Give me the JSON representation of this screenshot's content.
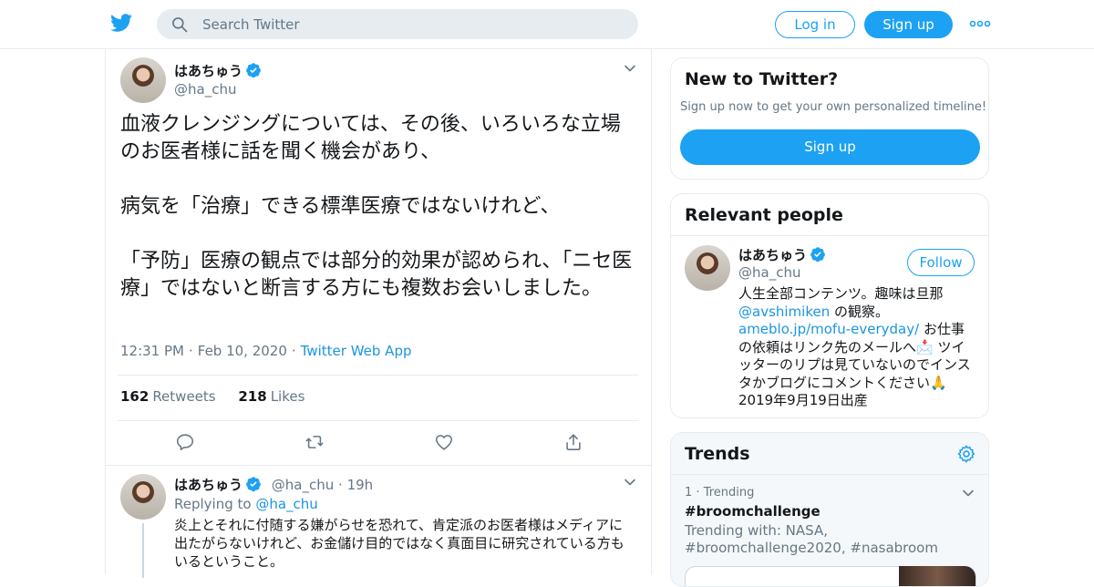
{
  "header": {
    "search_placeholder": "Search Twitter",
    "login_label": "Log in",
    "signup_label": "Sign up"
  },
  "tweet": {
    "author_name": "はあちゅう",
    "author_handle": "@ha_chu",
    "text": [
      "血液クレンジングについては、その後、いろいろな立場のお医者様に話を聞く機会があり、",
      "病気を「治療」できる標準医療ではないけれど、",
      "「予防」医療の観点では部分的効果が認められ、「ニセ医療」ではないと断言する方にも複数お会いしました。"
    ],
    "time": "12:31 PM",
    "date": "Feb 10, 2020",
    "source": "Twitter Web App",
    "retweets_count": "162",
    "retweets_label": "Retweets",
    "likes_count": "218",
    "likes_label": "Likes"
  },
  "reply": {
    "author_name": "はあちゅう",
    "author_handle": "@ha_chu",
    "age": "19h",
    "replying_prefix": "Replying to",
    "replying_to": "@ha_chu",
    "text": "炎上とそれに付随する嫌がらせを恐れて、肯定派のお医者様はメディアに出たがらないけれど、お金儲け目的ではなく真面目に研究されている方もいるということ。"
  },
  "sidebar": {
    "new_title": "New to Twitter?",
    "new_sub": "Sign up now to get your own personalized timeline!",
    "new_signup_label": "Sign up",
    "relevant_title": "Relevant people",
    "person_name": "はあちゅう",
    "person_handle": "@ha_chu",
    "follow_label": "Follow",
    "bio_part1": "人生全部コンテンツ。趣味は旦那",
    "bio_mention": "@avshimiken",
    "bio_part2": " の観察。",
    "bio_link": "ameblo.jp/mofu-everyday/",
    "bio_part3": " お仕事の依頼はリンク先のメールへ",
    "bio_emoji1": "📩",
    "bio_part4": " ツイッターのリプは見ていないのでインスタかブログにコメントください",
    "bio_emoji2": "🙏",
    "bio_part5": "2019年9月19日出産",
    "trends_title": "Trends",
    "trend_rank": "1",
    "trend_label": "Trending",
    "trend_name": "#broomchallenge",
    "trend_with": "Trending with: NASA, #broomchallenge2020, #nasabroom"
  },
  "colors": {
    "brand": "#1da1f2",
    "link": "#1b95e0",
    "text": "#14171a",
    "muted": "#657786",
    "border": "#e6ecf0"
  },
  "icons": [
    "twitter-bird-icon",
    "search-icon",
    "more-icon",
    "verified-icon",
    "chevron-down-icon",
    "reply-icon",
    "retweet-icon",
    "like-icon",
    "share-icon",
    "settings-gear-icon"
  ]
}
